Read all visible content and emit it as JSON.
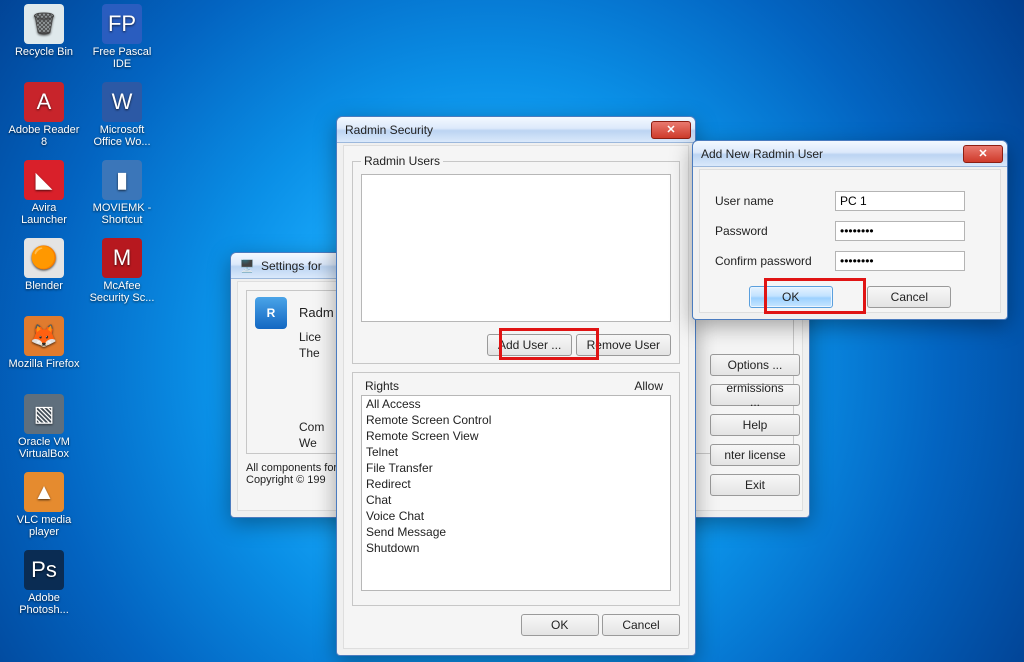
{
  "desktop_icons": [
    {
      "label": "Recycle Bin",
      "col": 0,
      "row": 0,
      "bg": "#dfe9ec",
      "glyph": "🗑"
    },
    {
      "label": "Free Pascal IDE",
      "col": 1,
      "row": 0,
      "bg": "#2a5dbf",
      "glyph": "FP"
    },
    {
      "label": "Adobe Reader 8",
      "col": 0,
      "row": 1,
      "bg": "#c8242b",
      "glyph": "A"
    },
    {
      "label": "Microsoft Office Wo...",
      "col": 1,
      "row": 1,
      "bg": "#2c59a5",
      "glyph": "W"
    },
    {
      "label": "Avira Launcher",
      "col": 0,
      "row": 2,
      "bg": "#d9202a",
      "glyph": "◣"
    },
    {
      "label": "MOVIEMK - Shortcut",
      "col": 1,
      "row": 2,
      "bg": "#3b76b9",
      "glyph": "▮"
    },
    {
      "label": "Blender",
      "col": 0,
      "row": 3,
      "bg": "#e4e4e4",
      "glyph": "🟠"
    },
    {
      "label": "McAfee Security Sc...",
      "col": 1,
      "row": 3,
      "bg": "#b7181f",
      "glyph": "M"
    },
    {
      "label": "Mozilla Firefox",
      "col": 0,
      "row": 4,
      "bg": "#e07b2e",
      "glyph": "🦊"
    },
    {
      "label": "Oracle VM VirtualBox",
      "col": 0,
      "row": 5,
      "bg": "#5f6f7d",
      "glyph": "▧"
    },
    {
      "label": "VLC media player",
      "col": 0,
      "row": 6,
      "bg": "#e58b2f",
      "glyph": "▲"
    },
    {
      "label": "Adobe Photosh...",
      "col": 0,
      "row": 7,
      "bg": "#0a2c53",
      "glyph": "Ps"
    }
  ],
  "settings_window": {
    "title": "Settings for",
    "product": "Radm",
    "lines": {
      "lic": "Lice",
      "the": "The",
      "com": "Com",
      "we": "We"
    },
    "footer_prefix": "All components for",
    "footer_copyright": "Copyright © 199"
  },
  "side_buttons": {
    "options": "Options ...",
    "permissions": "ermissions ...",
    "help": "Help",
    "enter_license": "nter license",
    "exit": "Exit"
  },
  "security_window": {
    "title": "Radmin Security",
    "users_legend": "Radmin Users",
    "add_user": "Add User ...",
    "remove_user": "Remove User",
    "rights_legend": "Rights",
    "allow_label": "Allow",
    "rights": [
      "All Access",
      "Remote Screen Control",
      "Remote Screen View",
      "Telnet",
      "File Transfer",
      "Redirect",
      "Chat",
      "Voice Chat",
      "Send Message",
      "Shutdown"
    ],
    "ok": "OK",
    "cancel": "Cancel"
  },
  "add_user_window": {
    "title": "Add New Radmin User",
    "username_label": "User name",
    "username_value": "PC 1",
    "password_label": "Password",
    "password_value": "••••••••",
    "confirm_label": "Confirm password",
    "confirm_value": "••••••••",
    "ok": "OK",
    "cancel": "Cancel"
  }
}
